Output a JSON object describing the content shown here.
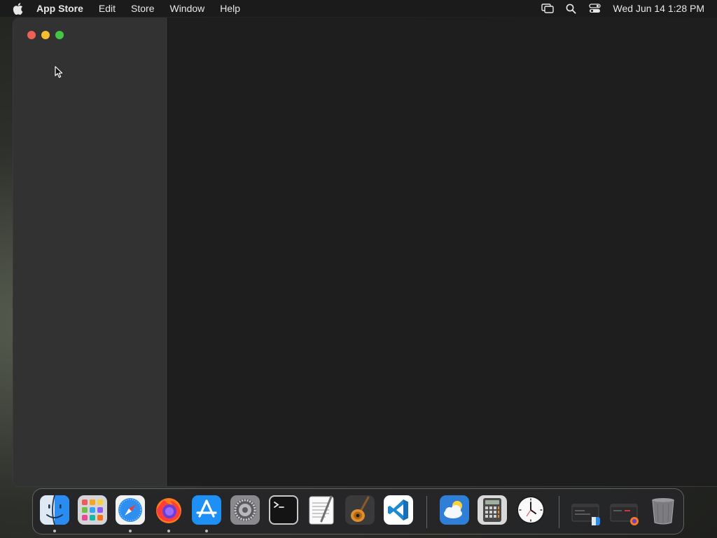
{
  "menubar": {
    "app_name": "App Store",
    "items": [
      "Edit",
      "Store",
      "Window",
      "Help"
    ],
    "clock": "Wed Jun 14  1:28 PM",
    "icons": [
      "apple-icon",
      "screen-mirroring-icon",
      "spotlight-search-icon",
      "control-center-icon"
    ]
  },
  "window": {
    "traffic_lights": [
      "close",
      "minimize",
      "zoom"
    ],
    "colors": {
      "close": "#ee5f57",
      "minimize": "#f5bd2f",
      "zoom": "#43c645"
    }
  },
  "dock": {
    "apps": [
      {
        "name": "Finder",
        "icon": "finder-icon",
        "running": true
      },
      {
        "name": "Launchpad",
        "icon": "launchpad-icon",
        "running": false
      },
      {
        "name": "Safari",
        "icon": "safari-icon",
        "running": true
      },
      {
        "name": "Firefox",
        "icon": "firefox-icon",
        "running": true
      },
      {
        "name": "App Store",
        "icon": "app-store-icon",
        "running": true
      },
      {
        "name": "System Settings",
        "icon": "system-settings-icon",
        "running": false
      },
      {
        "name": "Terminal",
        "icon": "terminal-icon",
        "running": false
      },
      {
        "name": "TextEdit",
        "icon": "textedit-icon",
        "running": false
      },
      {
        "name": "GarageBand",
        "icon": "garageband-icon",
        "running": false
      },
      {
        "name": "Visual Studio Code",
        "icon": "vscode-icon",
        "running": false
      },
      {
        "name": "Weather",
        "icon": "weather-icon",
        "running": false
      },
      {
        "name": "Calculator",
        "icon": "calculator-icon",
        "running": false
      },
      {
        "name": "Clock",
        "icon": "clock-icon",
        "running": false
      },
      {
        "name": "Finder Window",
        "icon": "minimized-finder-window-icon",
        "running": false
      },
      {
        "name": "Firefox Window",
        "icon": "minimized-firefox-window-icon",
        "running": false
      },
      {
        "name": "Trash",
        "icon": "trash-icon",
        "running": false
      }
    ]
  }
}
